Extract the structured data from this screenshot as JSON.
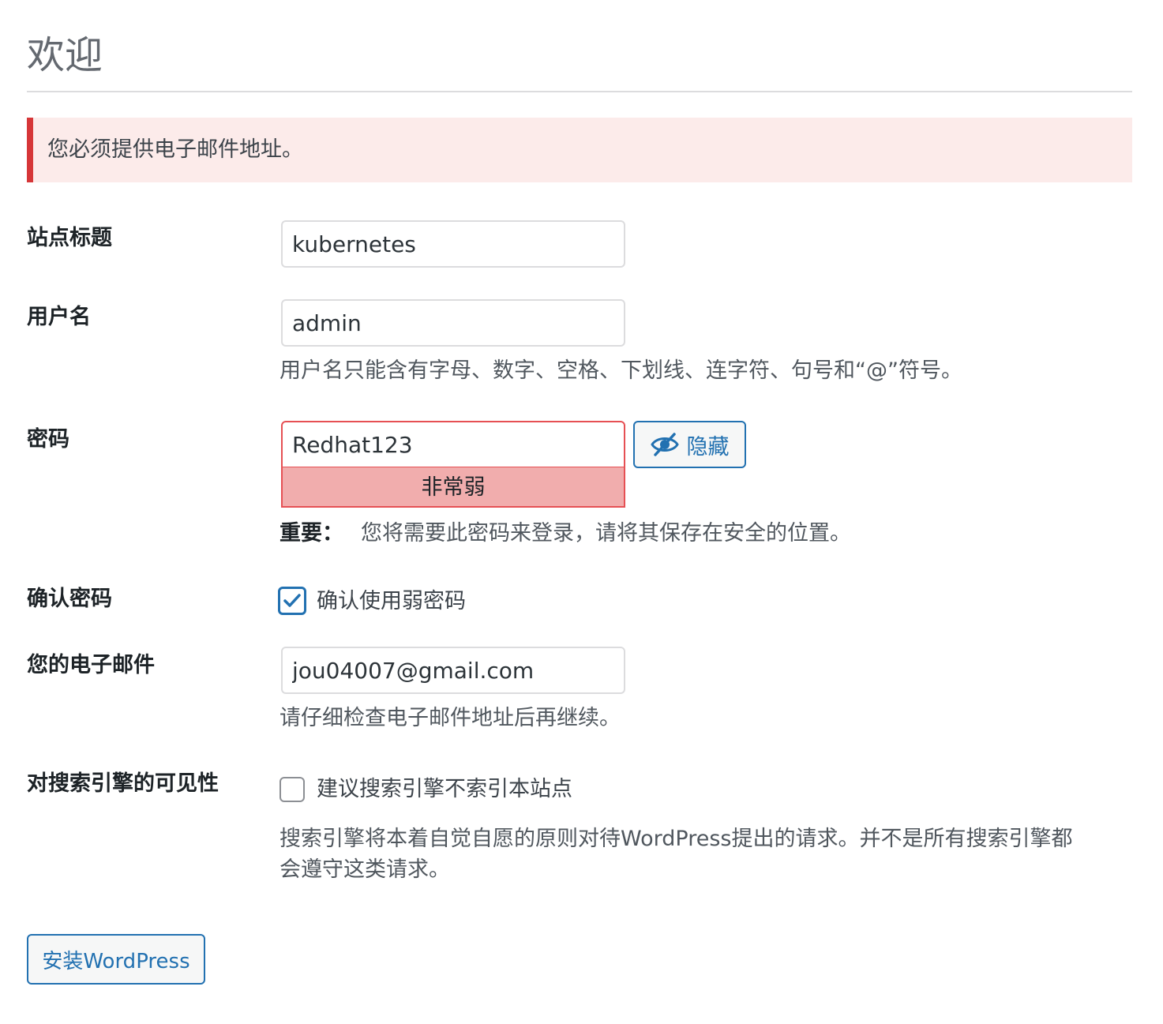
{
  "page": {
    "title": "欢迎"
  },
  "notice": {
    "text": "您必须提供电子邮件地址。"
  },
  "form": {
    "site_title": {
      "label": "站点标题",
      "value": "kubernetes"
    },
    "username": {
      "label": "用户名",
      "value": "admin",
      "description": "用户名只能含有字母、数字、空格、下划线、连字符、句号和“@”符号。"
    },
    "password": {
      "label": "密码",
      "value": "Redhat123",
      "strength": "非常弱",
      "hide_button": "隐藏",
      "important_label": "重要：",
      "important_text": "您将需要此密码来登录，请将其保存在安全的位置。"
    },
    "confirm_password": {
      "label": "确认密码",
      "checkbox_label": "确认使用弱密码",
      "checked": true
    },
    "email": {
      "label": "您的电子邮件",
      "value": "jou04007@gmail.com",
      "description": "请仔细检查电子邮件地址后再继续。"
    },
    "search_visibility": {
      "label": "对搜索引擎的可见性",
      "checkbox_label": "建议搜索引擎不索引本站点",
      "checked": false,
      "description_line1": "搜索引擎将本着自觉自愿的原则对待WordPress提出的请求。并不是所有搜索引擎都",
      "description_line2": "会遵守这类请求。"
    },
    "submit": {
      "label": "安装WordPress"
    }
  },
  "colors": {
    "accent": "#2271b1",
    "error": "#d63638",
    "notice_bg": "#fcebea",
    "strength_bg": "#f1adad"
  },
  "icons": {
    "hide_button_icon": "eye-slash-icon",
    "checkbox_check": "checkmark-icon"
  }
}
